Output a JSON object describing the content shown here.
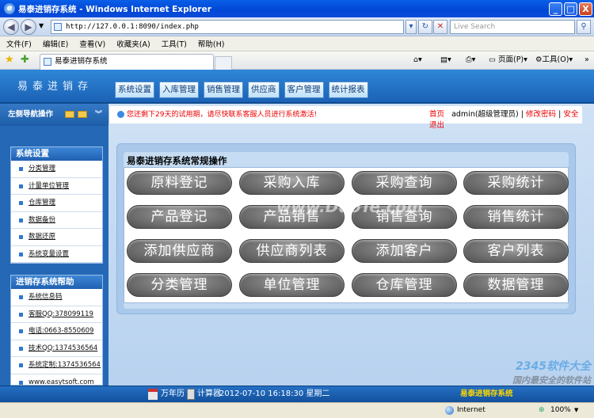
{
  "window": {
    "title": "易泰进销存系统 - Windows Internet Explorer",
    "controls": {
      "minimize": "_",
      "maximize": "□",
      "close": "X"
    }
  },
  "address_bar": {
    "url": "http://127.0.0.1:8090/index.php",
    "search_placeholder": "Live Search"
  },
  "menu": [
    "文件(F)",
    "编辑(E)",
    "查看(V)",
    "收藏夹(A)",
    "工具(T)",
    "帮助(H)"
  ],
  "tab": {
    "label": "易泰进销存系统"
  },
  "toolbar": {
    "page_label": "页面(P)",
    "tools_label": "工具(O)"
  },
  "app": {
    "logo": "易泰进销存",
    "nav": [
      "系统设置",
      "入库管理",
      "销售管理",
      "供应商",
      "客户管理",
      "统计报表"
    ]
  },
  "sidebar": {
    "heading": "左侧导航操作",
    "panels": [
      {
        "title": "系统设置",
        "items": [
          "分类管理",
          "计量单位管理",
          "仓库管理",
          "数据备份",
          "数据还原",
          "系统变量设置"
        ]
      },
      {
        "title": "进销存系统帮助",
        "items": [
          "系统信息码",
          "客服QQ:378099119",
          "电话:0663-8550609",
          "技术QQ:1374536564",
          "系统定制:1374536564",
          "www.easytsoft.com"
        ]
      }
    ]
  },
  "infobar": {
    "warning": "您还剩下29天的试用期，请尽快联系客服人员进行系统激活!",
    "home": "首页",
    "user": "admin(超级管理员)",
    "change_password": "修改密码",
    "logout": "安全退出",
    "sep": "|"
  },
  "operations": {
    "title": "易泰进销存系统常规操作",
    "buttons": [
      "原料登记",
      "采购入库",
      "采购查询",
      "采购统计",
      "产品登记",
      "产品销售",
      "销售查询",
      "销售统计",
      "添加供应商",
      "供应商列表",
      "添加客户",
      "客户列表",
      "分类管理",
      "单位管理",
      "仓库管理",
      "数据管理"
    ]
  },
  "footer": {
    "calendar": "万年历",
    "calculator": "计算器",
    "datetime": "2012-07-10 16:18:30 星期二",
    "brand": "易泰进销存系统"
  },
  "statusbar": {
    "zone": "Internet",
    "zoom": "100%"
  },
  "watermark": {
    "line1": "2345软件大全",
    "line2": "国内最安全的软件站",
    "site": "www.DuoTe.com"
  }
}
